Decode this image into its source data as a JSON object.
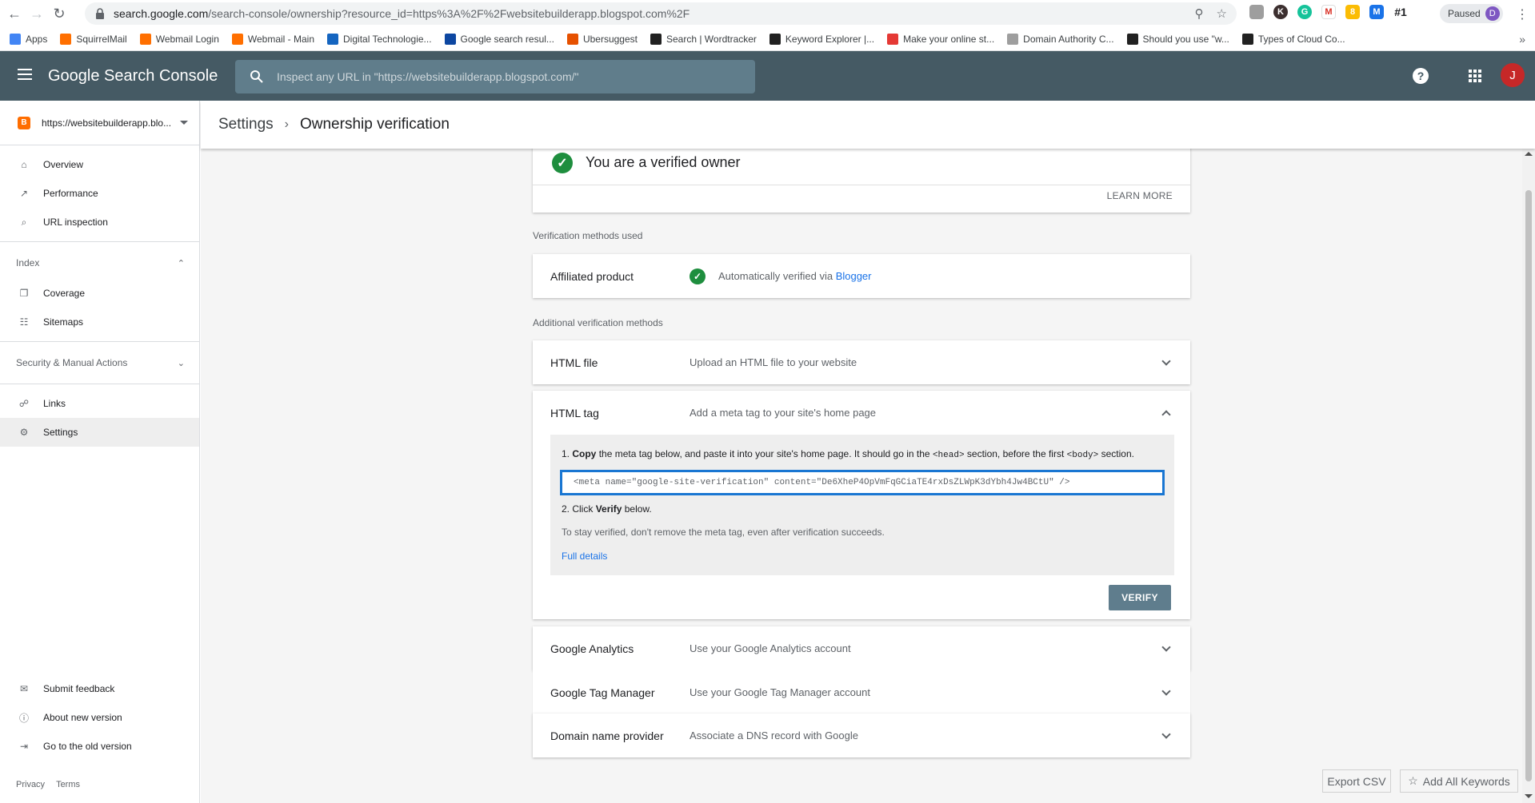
{
  "browser": {
    "url_host": "search.google.com",
    "url_path": "/search-console/ownership?resource_id=https%3A%2F%2Fwebsitebuilderapp.blogspot.com%2F",
    "extension_badge": "#1",
    "profile_status": "Paused",
    "profile_initial": "D"
  },
  "bookmarks": [
    {
      "label": "Apps",
      "color": "#4285f4"
    },
    {
      "label": "SquirrelMail",
      "color": "#ff6f00"
    },
    {
      "label": "Webmail Login",
      "color": "#ff6f00"
    },
    {
      "label": "Webmail - Main",
      "color": "#ff6f00"
    },
    {
      "label": "Digital Technologie...",
      "color": "#1565c0"
    },
    {
      "label": "Google search resul...",
      "color": "#0d47a1"
    },
    {
      "label": "Ubersuggest",
      "color": "#e65100"
    },
    {
      "label": "Search | Wordtracker",
      "color": "#212121"
    },
    {
      "label": "Keyword Explorer |...",
      "color": "#212121"
    },
    {
      "label": "Make your online st...",
      "color": "#e53935"
    },
    {
      "label": "Domain Authority C...",
      "color": "#9e9e9e"
    },
    {
      "label": "Should you use \"w...",
      "color": "#212121"
    },
    {
      "label": "Types of Cloud Co...",
      "color": "#212121"
    }
  ],
  "header": {
    "title": "Google Search Console",
    "search_placeholder": "Inspect any URL in \"https://websitebuilderapp.blogspot.com/\"",
    "avatar_initial": "J"
  },
  "sidebar": {
    "property": "https://websitebuilderapp.blo...",
    "items_top": [
      {
        "label": "Overview",
        "icon": "home-icon"
      },
      {
        "label": "Performance",
        "icon": "trending-up-icon"
      },
      {
        "label": "URL inspection",
        "icon": "search-icon"
      }
    ],
    "index_label": "Index",
    "items_index": [
      {
        "label": "Coverage",
        "icon": "copy-icon"
      },
      {
        "label": "Sitemaps",
        "icon": "sitemap-icon"
      }
    ],
    "security_label": "Security & Manual Actions",
    "items_bottom": [
      {
        "label": "Links",
        "icon": "links-icon"
      },
      {
        "label": "Settings",
        "icon": "gear-icon"
      }
    ],
    "footer_items": [
      {
        "label": "Submit feedback",
        "icon": "feedback-icon"
      },
      {
        "label": "About new version",
        "icon": "info-icon"
      },
      {
        "label": "Go to the old version",
        "icon": "exit-icon"
      }
    ],
    "privacy": "Privacy",
    "terms": "Terms"
  },
  "breadcrumb": {
    "parent": "Settings",
    "current": "Ownership verification"
  },
  "verified": {
    "title": "You are a verified owner",
    "learn_more": "LEARN MORE"
  },
  "methods_used_label": "Verification methods used",
  "affiliated": {
    "name": "Affiliated product",
    "desc_prefix": "Automatically verified via",
    "link": "Blogger"
  },
  "additional_label": "Additional verification methods",
  "methods": {
    "html_file": {
      "name": "HTML file",
      "desc": "Upload an HTML file to your website"
    },
    "html_tag": {
      "name": "HTML tag",
      "desc": "Add a meta tag to your site's home page"
    },
    "analytics": {
      "name": "Google Analytics",
      "desc": "Use your Google Analytics account"
    },
    "tag_manager": {
      "name": "Google Tag Manager",
      "desc": "Use your Google Tag Manager account"
    },
    "domain": {
      "name": "Domain name provider",
      "desc": "Associate a DNS record with Google"
    }
  },
  "html_tag_panel": {
    "step1_num": "1.",
    "step1_bold": "Copy",
    "step1_text_a": "the meta tag below, and paste it into your site's home page. It should go in the",
    "step1_code_head": "<head>",
    "step1_text_b": "section, before the first",
    "step1_code_body": "<body>",
    "step1_text_c": "section.",
    "meta_tag": "<meta name=\"google-site-verification\" content=\"De6XheP4OpVmFqGCiaTE4rxDsZLWpK3dYbh4Jw4BCtU\" />",
    "step2_prefix": "2. Click",
    "step2_bold": "Verify",
    "step2_suffix": "below.",
    "stay_note": "To stay verified, don't remove the meta tag, even after verification succeeds.",
    "full_details": "Full details",
    "verify_label": "VERIFY"
  },
  "footer_buttons": {
    "export_csv": "Export CSV",
    "add_keywords": "Add All Keywords"
  },
  "colors": {
    "header_bg": "#455a64",
    "verified_green": "#1e8e3e",
    "link_blue": "#1a73e8",
    "verify_btn": "#5f7d8d"
  }
}
